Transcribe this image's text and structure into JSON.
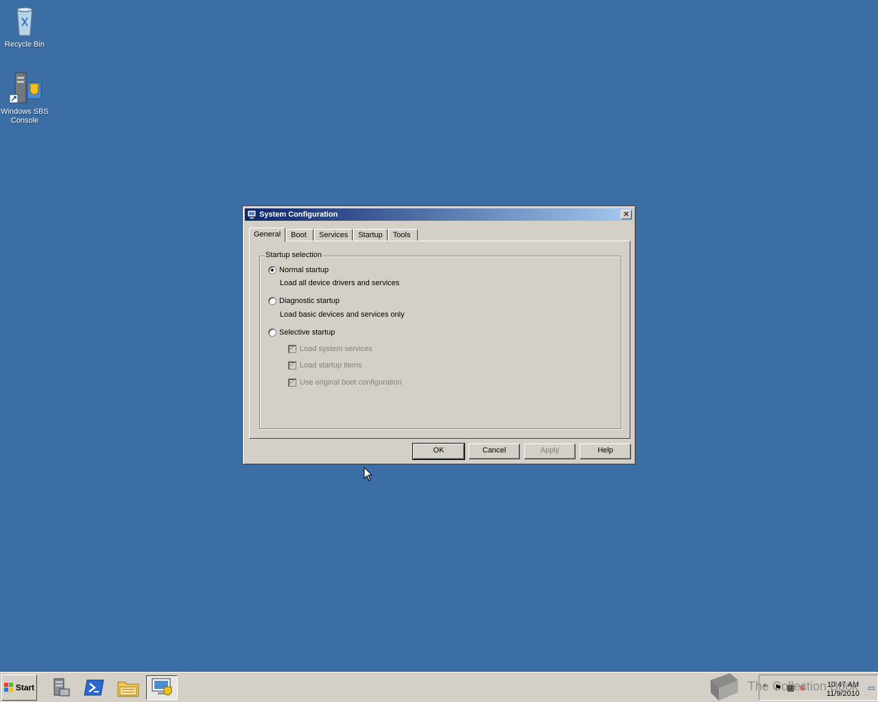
{
  "desktop": {
    "icons": [
      {
        "label": "Recycle Bin",
        "icon": "recycle-bin-icon"
      },
      {
        "label": "Windows SBS Console",
        "icon": "server-console-icon"
      }
    ]
  },
  "dialog": {
    "title": "System Configuration",
    "close_label": "✕",
    "tabs": [
      {
        "label": "General",
        "active": true
      },
      {
        "label": "Boot"
      },
      {
        "label": "Services"
      },
      {
        "label": "Startup"
      },
      {
        "label": "Tools"
      }
    ],
    "group_title": "Startup selection",
    "options": [
      {
        "label": "Normal startup",
        "desc": "Load all device drivers and services",
        "selected": true
      },
      {
        "label": "Diagnostic startup",
        "desc": "Load basic devices and services only",
        "selected": false
      },
      {
        "label": "Selective startup",
        "selected": false
      }
    ],
    "selective_items": [
      {
        "label": "Load system services",
        "checked": true,
        "enabled": false
      },
      {
        "label": "Load startup items",
        "checked": true,
        "enabled": false
      },
      {
        "label": "Use original boot configuration",
        "checked": true,
        "enabled": false
      }
    ],
    "buttons": {
      "ok": "OK",
      "cancel": "Cancel",
      "apply": "Apply",
      "help": "Help"
    }
  },
  "taskbar": {
    "start_label": "Start",
    "items": [
      "server-manager-icon",
      "powershell-icon",
      "file-explorer-icon",
      "system-configuration-icon"
    ],
    "clock_time": "10:47 AM",
    "clock_date": "11/9/2010",
    "watermark_text": "The Collection Book"
  },
  "colors": {
    "desktop": "#3a6ea5",
    "dialog_face": "#d4d0c8",
    "titlebar_start": "#0a246a",
    "titlebar_end": "#a6caf0"
  }
}
